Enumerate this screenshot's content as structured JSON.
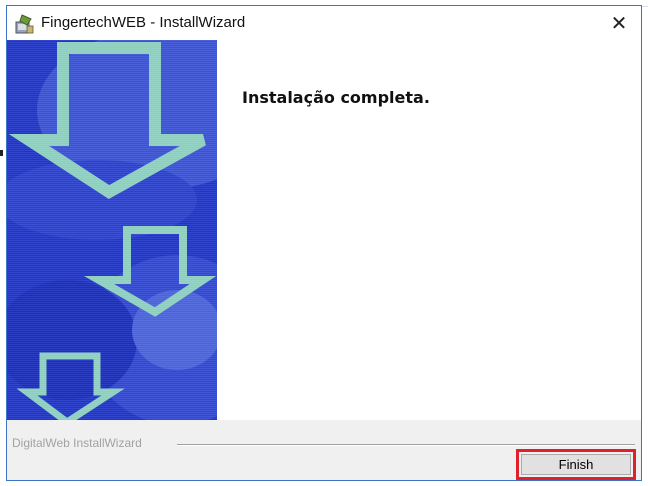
{
  "window": {
    "title": "FingertechWEB - InstallWizard",
    "close_symbol": "✕",
    "app_icon": "setup-icon"
  },
  "main": {
    "heading": "Instalação completa."
  },
  "footer": {
    "brand_label": "DigitalWeb InstallWizard",
    "finish_label": "Finish"
  },
  "colors": {
    "banner_blue": "#1f35c9",
    "arrow_green": "#8ccfc0",
    "highlight_red": "#e0202a",
    "window_border": "#3d73c5"
  }
}
